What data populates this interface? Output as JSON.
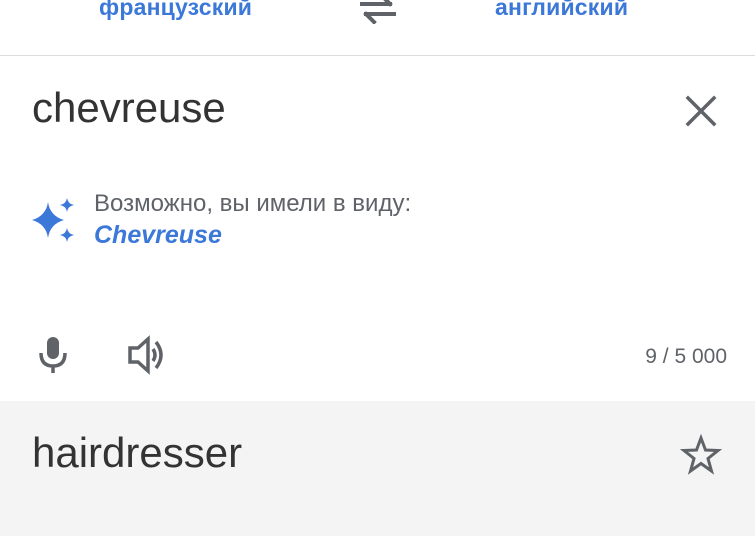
{
  "languages": {
    "source": "французский",
    "target": "английский",
    "swap_icon": "swap-arrows-icon"
  },
  "input": {
    "text": "chevreuse",
    "clear_icon": "close-icon"
  },
  "suggestion": {
    "label": "Возможно, вы имели в виду:",
    "word": "Chevreuse",
    "icon": "sparkle-icon"
  },
  "tools": {
    "mic_icon": "microphone-icon",
    "speaker_icon": "speaker-icon",
    "char_count": "9 / 5 000"
  },
  "result": {
    "text": "hairdresser",
    "star_icon": "star-outline-icon"
  },
  "colors": {
    "accent": "#3b78d8",
    "text": "#333333",
    "secondary_text": "#5f6368",
    "result_bg": "#f4f4f4",
    "divider": "#dadce0"
  }
}
